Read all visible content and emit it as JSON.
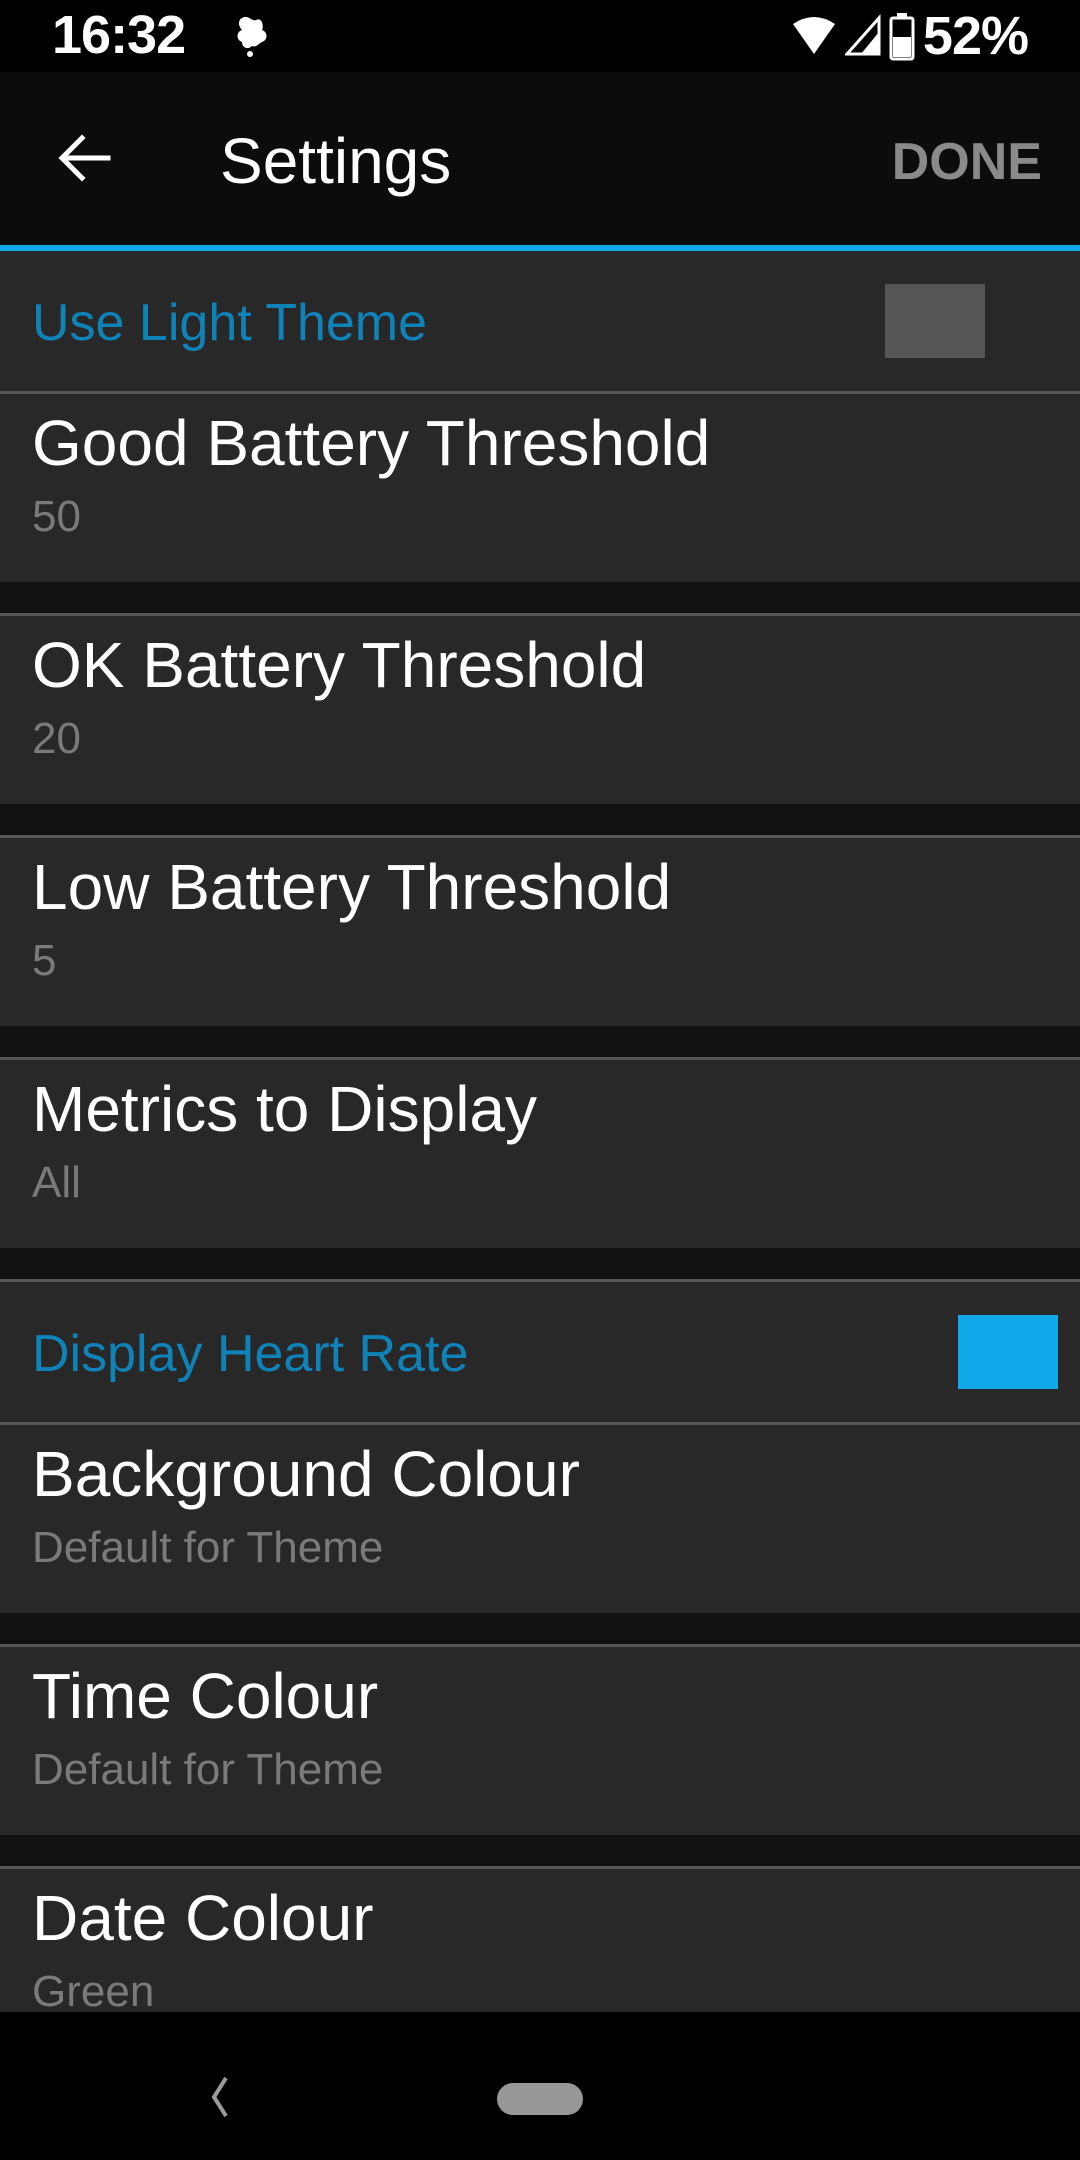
{
  "status_bar": {
    "time": "16:32",
    "notification_icon": "app-notification-icon",
    "wifi_icon": "wifi-icon",
    "signal_icon": "cell-signal-icon",
    "battery_icon": "battery-icon",
    "battery_percent": "52%"
  },
  "app_bar": {
    "back_icon": "arrow-left-icon",
    "title": "Settings",
    "done_label": "DONE"
  },
  "colors": {
    "accent": "#10a8e8",
    "toggle_label": "#0f82b8",
    "toggle_off": "#555555",
    "item_background": "#282828",
    "subtitle": "#7a7a7a"
  },
  "settings": {
    "use_light_theme": {
      "label": "Use Light Theme",
      "checked": false
    },
    "items_group_1": [
      {
        "title": "Good Battery Threshold",
        "value": "50"
      },
      {
        "title": "OK Battery Threshold",
        "value": "20"
      },
      {
        "title": "Low Battery Threshold",
        "value": "5"
      },
      {
        "title": "Metrics to Display",
        "value": "All"
      }
    ],
    "display_heart_rate": {
      "label": "Display Heart Rate",
      "checked": true
    },
    "items_group_2": [
      {
        "title": "Background Colour",
        "value": "Default for Theme"
      },
      {
        "title": "Time Colour",
        "value": "Default for Theme"
      },
      {
        "title": "Date Colour",
        "value": "Green"
      }
    ]
  },
  "nav_bar": {
    "back_icon": "nav-back-icon",
    "home_icon": "nav-home-pill-icon"
  }
}
